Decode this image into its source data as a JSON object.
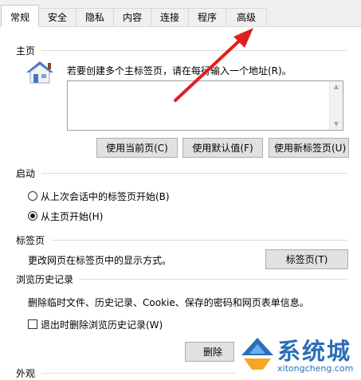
{
  "tabs": [
    "常规",
    "安全",
    "隐私",
    "内容",
    "连接",
    "程序",
    "高级"
  ],
  "home": {
    "group_label": "主页",
    "instruction": "若要创建多个主标签页，请在每行输入一个地址(R)。",
    "url_value": "",
    "btn_current": "使用当前页(C)",
    "btn_default": "使用默认值(F)",
    "btn_newtab": "使用新标签页(U)"
  },
  "startup": {
    "group_label": "启动",
    "option_last_session": "从上次会话中的标签页开始(B)",
    "option_home": "从主页开始(H)",
    "selected": "home"
  },
  "tabs_section": {
    "group_label": "标签页",
    "description": "更改网页在标签页中的显示方式。",
    "button": "标签页(T)"
  },
  "history": {
    "group_label": "浏览历史记录",
    "description": "删除临时文件、历史记录、Cookie、保存的密码和网页表单信息。",
    "checkbox_label": "退出时删除浏览历史记录(W)",
    "checked": false,
    "delete_button": "删除"
  },
  "appearance": {
    "group_label": "外观"
  },
  "watermark": {
    "brand": "系统城",
    "url": "xitongcheng.com"
  },
  "colors": {
    "arrow": "#e02020",
    "watermark": "#2b6fb6"
  }
}
